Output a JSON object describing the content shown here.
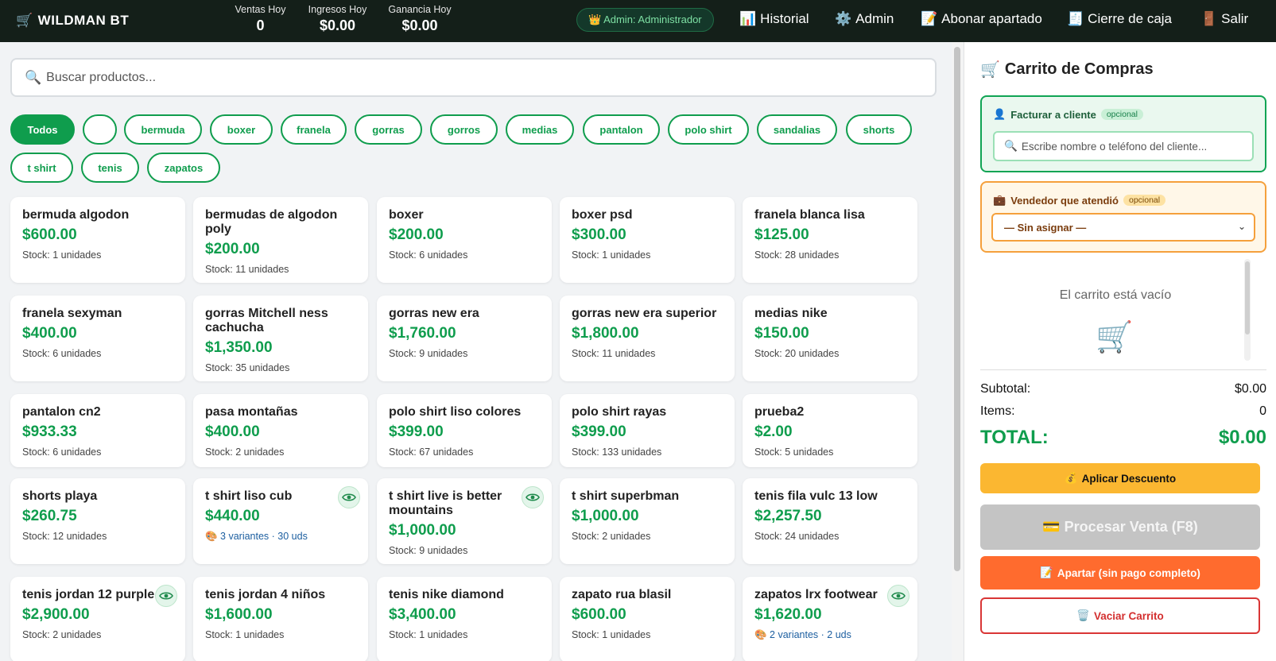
{
  "brand": {
    "icon": "cart-icon",
    "name": "WILDMAN BT"
  },
  "stats": [
    {
      "label": "Ventas Hoy",
      "value": "0"
    },
    {
      "label": "Ingresos Hoy",
      "value": "$0.00"
    },
    {
      "label": "Ganancia Hoy",
      "value": "$0.00"
    }
  ],
  "admin_badge": "👑 Admin: Administrador",
  "nav": [
    {
      "icon": "📊",
      "label": "Historial"
    },
    {
      "icon": "⚙️",
      "label": "Admin"
    },
    {
      "icon": "📝",
      "label": "Abonar apartado"
    },
    {
      "icon": "🧾",
      "label": "Cierre de caja"
    },
    {
      "icon": "🚪",
      "label": "Salir"
    }
  ],
  "search": {
    "placeholder": "Buscar productos..."
  },
  "categories": [
    "Todos",
    "",
    "bermuda",
    "boxer",
    "franela",
    "gorras",
    "gorros",
    "medias",
    "pantalon",
    "polo shirt",
    "sandalias",
    "shorts",
    "t shirt",
    "tenis",
    "zapatos"
  ],
  "products": [
    {
      "name": "bermuda algodon",
      "price": "$600.00",
      "stock": "Stock: 1 unidades"
    },
    {
      "name": "bermudas de algodon poly",
      "price": "$200.00",
      "stock": "Stock: 11 unidades"
    },
    {
      "name": "boxer",
      "price": "$200.00",
      "stock": "Stock: 6 unidades"
    },
    {
      "name": "boxer psd",
      "price": "$300.00",
      "stock": "Stock: 1 unidades"
    },
    {
      "name": "franela blanca lisa",
      "price": "$125.00",
      "stock": "Stock: 28 unidades"
    },
    {
      "name": "franela sexyman",
      "price": "$400.00",
      "stock": "Stock: 6 unidades"
    },
    {
      "name": "gorras Mitchell ness cachucha",
      "price": "$1,350.00",
      "stock": "Stock: 35 unidades"
    },
    {
      "name": "gorras new era",
      "price": "$1,760.00",
      "stock": "Stock: 9 unidades"
    },
    {
      "name": "gorras new era superior",
      "price": "$1,800.00",
      "stock": "Stock: 11 unidades"
    },
    {
      "name": "medias nike",
      "price": "$150.00",
      "stock": "Stock: 20 unidades"
    },
    {
      "name": "pantalon cn2",
      "price": "$933.33",
      "stock": "Stock: 6 unidades"
    },
    {
      "name": "pasa montañas",
      "price": "$400.00",
      "stock": "Stock: 2 unidades"
    },
    {
      "name": "polo shirt liso colores",
      "price": "$399.00",
      "stock": "Stock: 67 unidades"
    },
    {
      "name": "polo shirt rayas",
      "price": "$399.00",
      "stock": "Stock: 133 unidades"
    },
    {
      "name": "prueba2",
      "price": "$2.00",
      "stock": "Stock: 5 unidades"
    },
    {
      "name": "shorts playa",
      "price": "$260.75",
      "stock": "Stock: 12 unidades"
    },
    {
      "name": "t shirt liso cub",
      "price": "$440.00",
      "variants": "🎨 3 variantes · 30 uds",
      "eye": true
    },
    {
      "name": "t shirt live is better mountains",
      "price": "$1,000.00",
      "stock": "Stock: 9 unidades",
      "eye": true
    },
    {
      "name": "t shirt superbman",
      "price": "$1,000.00",
      "stock": "Stock: 2 unidades"
    },
    {
      "name": "tenis fila vulc 13 low",
      "price": "$2,257.50",
      "stock": "Stock: 24 unidades"
    },
    {
      "name": "tenis jordan 12 purple",
      "price": "$2,900.00",
      "stock": "Stock: 2 unidades",
      "eye": true
    },
    {
      "name": "tenis jordan 4 niños",
      "price": "$1,600.00",
      "stock": "Stock: 1 unidades"
    },
    {
      "name": "tenis nike diamond",
      "price": "$3,400.00",
      "stock": "Stock: 1 unidades"
    },
    {
      "name": "zapato rua blasil",
      "price": "$600.00",
      "stock": "Stock: 1 unidades"
    },
    {
      "name": "zapatos lrx footwear",
      "price": "$1,620.00",
      "variants": "🎨 2 variantes · 2 uds",
      "eye": true
    }
  ],
  "cart": {
    "title": "Carrito de Compras",
    "customer_label": "Facturar a cliente",
    "optional": "opcional",
    "customer_placeholder": "Escribe nombre o teléfono del cliente...",
    "seller_label": "Vendedor que atendió",
    "seller_value": "— Sin asignar —",
    "empty_text": "El carrito está vacío",
    "subtotal_label": "Subtotal:",
    "subtotal_value": "$0.00",
    "items_label": "Items:",
    "items_value": "0",
    "total_label": "TOTAL:",
    "total_value": "$0.00",
    "btn_discount": "Aplicar Descuento",
    "btn_process": "Procesar Venta (F8)",
    "btn_layaway": "Apartar (sin pago completo)",
    "btn_empty": "Vaciar Carrito"
  },
  "colors": {
    "accent": "#0f9d4d",
    "topbar": "#141f19",
    "discount": "#fbb731",
    "layaway": "#ff6b2e",
    "danger": "#d32f2f"
  }
}
